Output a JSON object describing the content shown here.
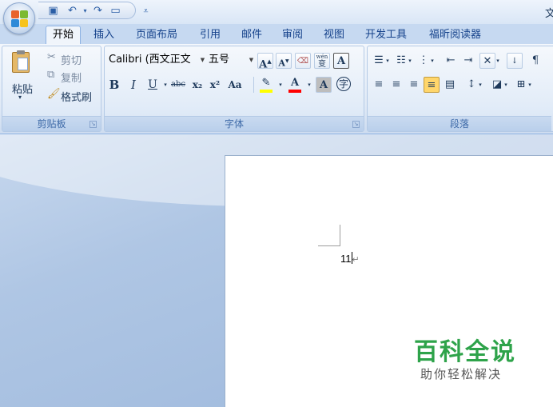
{
  "window": {
    "title_fragment": "文"
  },
  "quick_access": {
    "icons": [
      "save-icon",
      "undo-icon",
      "redo-icon",
      "print-preview-icon",
      "customize-icon"
    ]
  },
  "tabs": [
    {
      "label": "开始",
      "active": true
    },
    {
      "label": "插入"
    },
    {
      "label": "页面布局"
    },
    {
      "label": "引用"
    },
    {
      "label": "邮件"
    },
    {
      "label": "审阅"
    },
    {
      "label": "视图"
    },
    {
      "label": "开发工具"
    },
    {
      "label": "福昕阅读器"
    }
  ],
  "clipboard": {
    "paste": "粘贴",
    "cut": "剪切",
    "copy": "复制",
    "format_painter": "格式刷",
    "group_label": "剪贴板"
  },
  "font": {
    "font_name": "Calibri (西文正文",
    "font_size": "五号",
    "grow": "A",
    "shrink": "A",
    "bold": "B",
    "italic": "I",
    "underline": "U",
    "strikethrough": "abc",
    "subscript": "x₂",
    "superscript": "x²",
    "change_case": "Aa",
    "font_color": "A",
    "char_shading": "A",
    "enclose": "字",
    "phonetic": "wén",
    "group_label": "字体"
  },
  "paragraph": {
    "group_label": "段落"
  },
  "document": {
    "text": "11"
  },
  "watermark": {
    "title": "百科全说",
    "subtitle": "助你轻松解决"
  },
  "colors": {
    "highlight": "#ffff00",
    "font_color_bar": "#ff0000",
    "watermark_green": "#2ea34a"
  }
}
